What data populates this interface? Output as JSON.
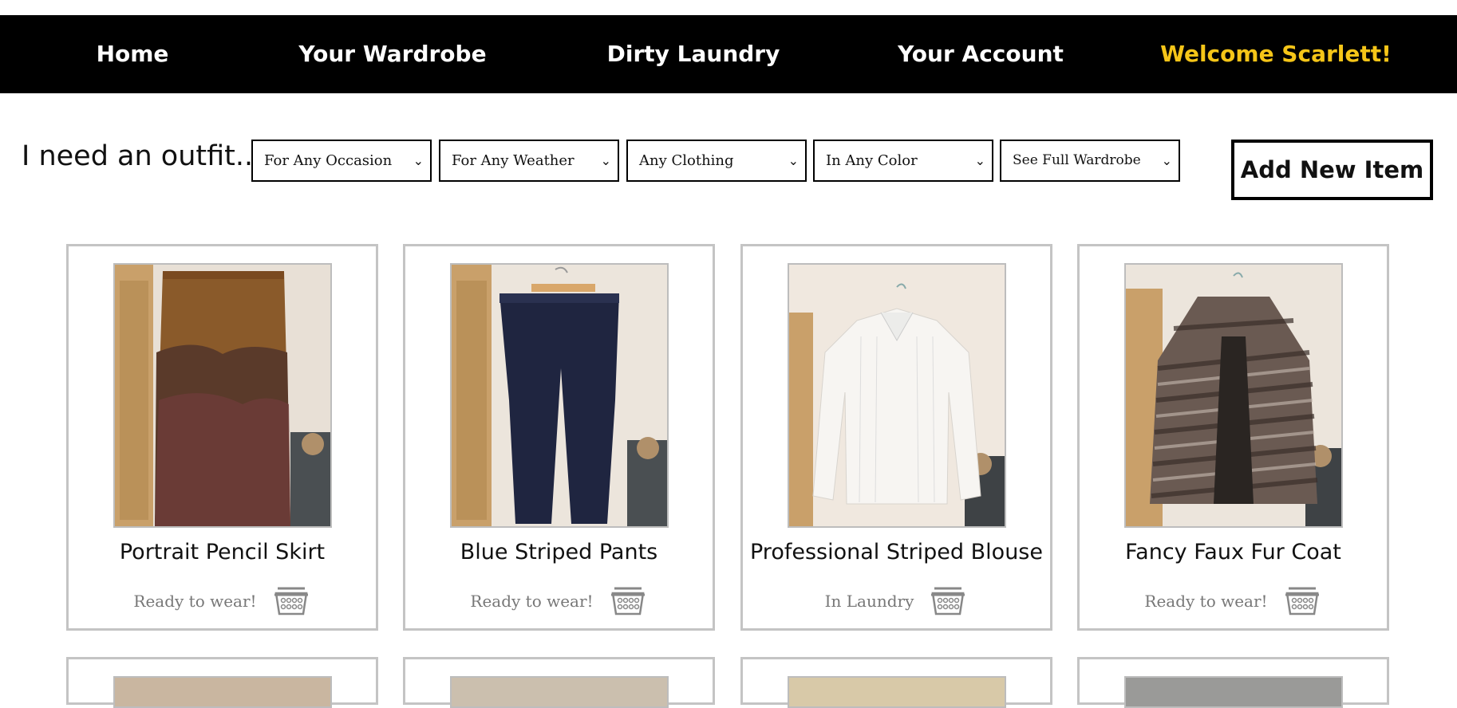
{
  "nav": {
    "home": "Home",
    "wardrobe": "Your Wardrobe",
    "laundry": "Dirty Laundry",
    "account": "Your Account",
    "welcome": "Welcome Scarlett!",
    "welcome_color": "#f5c518"
  },
  "filters": {
    "label": "I need an outfit...",
    "occasion": "For Any Occasion",
    "weather": "For Any Weather",
    "clothing": "Any Clothing",
    "color": "In Any Color",
    "view": "See Full Wardrobe"
  },
  "add_button": "Add New Item",
  "items": [
    {
      "title": "Portrait Pencil Skirt",
      "status": "Ready to wear!",
      "icon": "laundry-basket-icon"
    },
    {
      "title": "Blue Striped Pants",
      "status": "Ready to wear!",
      "icon": "laundry-basket-icon"
    },
    {
      "title": "Professional Striped Blouse",
      "status": "In Laundry",
      "icon": "laundry-basket-icon"
    },
    {
      "title": "Fancy Faux Fur Coat",
      "status": "Ready to wear!",
      "icon": "laundry-basket-icon"
    }
  ]
}
